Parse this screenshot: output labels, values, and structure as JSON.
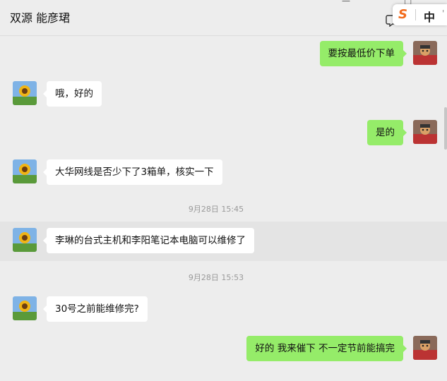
{
  "window": {
    "title": "双源 能彦珺",
    "controls": [
      "—",
      "□",
      "✕"
    ]
  },
  "ime": {
    "logo": "S",
    "mode": "中",
    "extra": "'"
  },
  "messages": [
    {
      "dir": "out",
      "text": "要按最低价下单"
    },
    {
      "dir": "in",
      "text": "哦，好的"
    },
    {
      "dir": "out",
      "text": "是的"
    },
    {
      "dir": "in",
      "text": "大华网线是否少下了3箱单，核实一下"
    },
    {
      "dir": "in",
      "text": "李琳的台式主机和李阳笔记本电脑可以维修了"
    },
    {
      "dir": "in",
      "text": "30号之前能维修完?"
    },
    {
      "dir": "out",
      "text": "好的 我来催下 不一定节前能搞完"
    }
  ],
  "timestamps": [
    "9月28日 15:45",
    "9月28日 15:53"
  ],
  "colors": {
    "background": "#ededed",
    "outgoing_bubble": "#95ec69",
    "incoming_bubble": "#ffffff",
    "timestamp_text": "#9a9a9a"
  }
}
